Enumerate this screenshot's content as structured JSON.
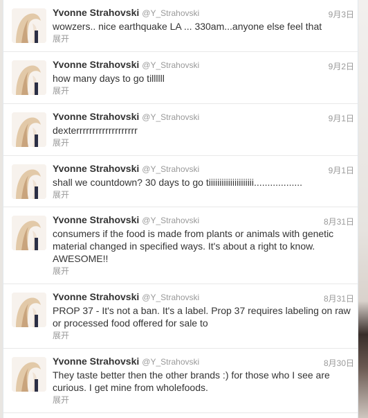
{
  "expand_label": "展开",
  "tweets": [
    {
      "name": "Yvonne Strahovski",
      "handle": "@Y_Strahovski",
      "date": "9月3日",
      "text": "wowzers.. nice earthquake LA ... 330am...anyone else feel that"
    },
    {
      "name": "Yvonne Strahovski",
      "handle": "@Y_Strahovski",
      "date": "9月2日",
      "text": "how many days to go tillllll"
    },
    {
      "name": "Yvonne Strahovski",
      "handle": "@Y_Strahovski",
      "date": "9月1日",
      "text": "dexterrrrrrrrrrrrrrrrrrr"
    },
    {
      "name": "Yvonne Strahovski",
      "handle": "@Y_Strahovski",
      "date": "9月1日",
      "text": "shall we countdown? 30 days to go tiiiiiiiiiiiiiiiiiiiii.................."
    },
    {
      "name": "Yvonne Strahovski",
      "handle": "@Y_Strahovski",
      "date": "8月31日",
      "text": "consumers if the food is made from plants or animals with genetic material changed in specified ways. It's about a right to know. AWESOME!!"
    },
    {
      "name": "Yvonne Strahovski",
      "handle": "@Y_Strahovski",
      "date": "8月31日",
      "text": "PROP 37 - It's not a ban. It's a label. Prop 37 requires labeling on raw or processed food offered for sale to"
    },
    {
      "name": "Yvonne Strahovski",
      "handle": "@Y_Strahovski",
      "date": "8月30日",
      "text": "They taste better then the other brands :) for those who I see are curious. I get mine from wholefoods."
    }
  ]
}
